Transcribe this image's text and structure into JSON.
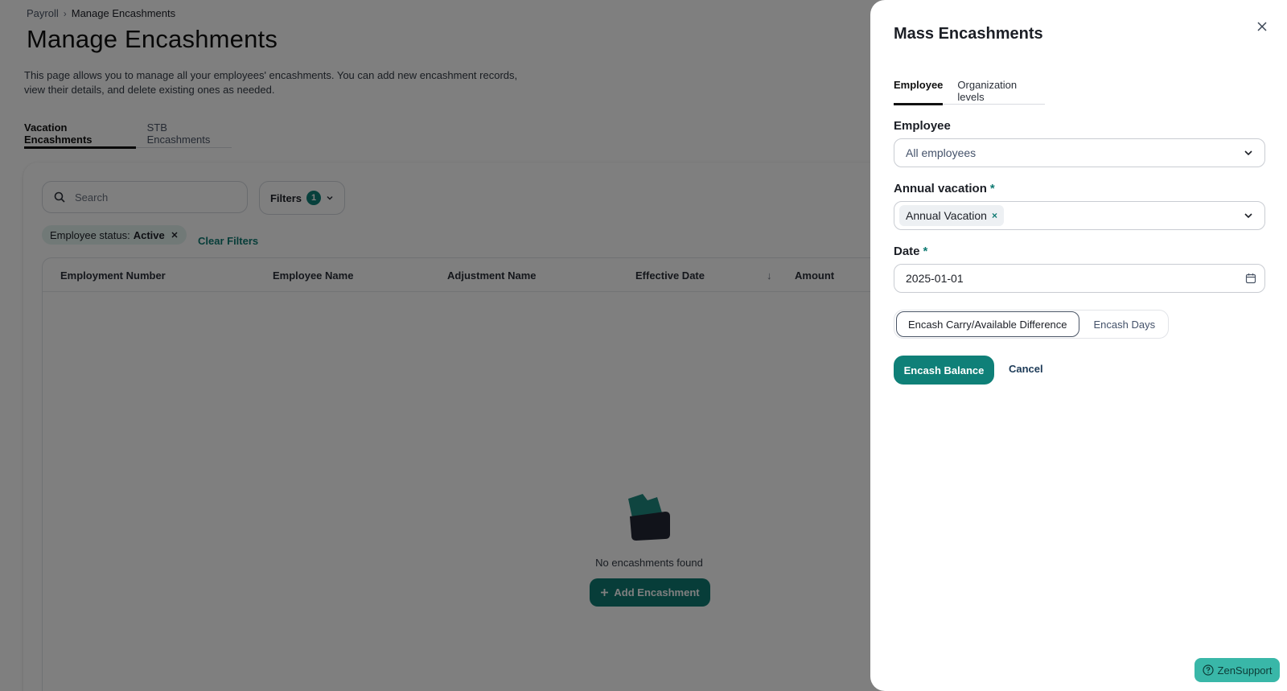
{
  "breadcrumb": {
    "parent": "Payroll",
    "separator": "›",
    "current": "Manage Encashments"
  },
  "page": {
    "title": "Manage Encashments",
    "description": "This page allows you to manage all your employees' encashments. You can add new encashment records, view their details, and delete existing ones as needed."
  },
  "tabs": [
    {
      "label": "Vacation Encashments",
      "active": true
    },
    {
      "label": "STB Encashments",
      "active": false
    }
  ],
  "search": {
    "placeholder": "Search"
  },
  "filters": {
    "label": "Filters",
    "count": "1"
  },
  "active_filter": {
    "key": "Employee status:",
    "value": "Active"
  },
  "clear_filters": "Clear Filters",
  "table": {
    "columns": [
      "Employment Number",
      "Employee Name",
      "Adjustment Name",
      "Effective Date",
      "Amount"
    ],
    "sort_indicator": "↓"
  },
  "empty_state": {
    "text": "No encashments found",
    "button": "Add Encashment"
  },
  "drawer": {
    "title": "Mass Encashments",
    "close_icon": "×",
    "tabs": [
      {
        "label": "Employee",
        "active": true
      },
      {
        "label": "Organization levels",
        "active": false
      }
    ],
    "employee": {
      "label": "Employee",
      "value": "All employees"
    },
    "annual_vacation": {
      "label": "Annual vacation",
      "required_mark": "*",
      "tag": "Annual Vacation",
      "tag_remove": "×"
    },
    "date": {
      "label": "Date",
      "required_mark": "*",
      "value": "2025-01-01"
    },
    "mode": {
      "options": [
        "Encash Carry/Available Difference",
        "Encash Days"
      ],
      "selected": "Encash Carry/Available Difference"
    },
    "submit": "Encash Balance",
    "cancel": "Cancel"
  },
  "support": {
    "label": "ZenSupport"
  },
  "colors": {
    "accent": "#0f8078",
    "overlay": "rgba(0,0,0,0.5)",
    "support": "#39b7a8"
  }
}
